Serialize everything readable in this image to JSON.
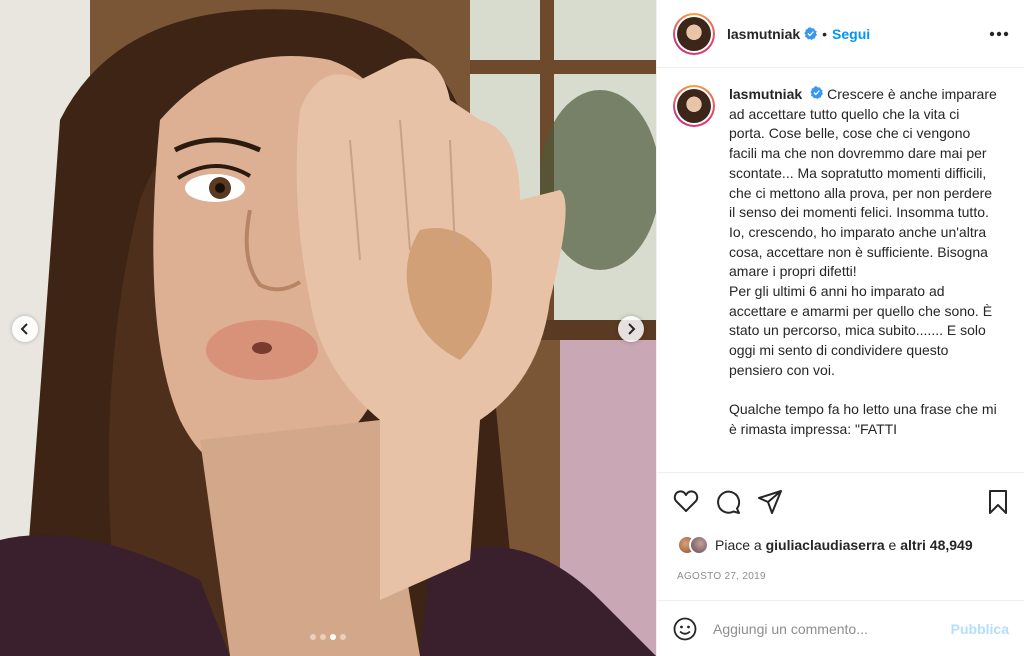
{
  "post": {
    "username": "lasmutniak",
    "follow_label": "Segui",
    "separator": "•",
    "caption": "Crescere è anche imparare ad accettare tutto quello che la vita ci porta. Cose belle, cose che ci vengono facili ma che non dovremmo dare mai per scontate... Ma sopratutto momenti difficili, che ci mettono alla prova, per non perdere il senso dei momenti felici. Insomma tutto.\nIo, crescendo, ho imparato anche un'altra cosa, accettare non è sufficiente. Bisogna amare i propri difetti!\nPer gli ultimi 6 anni ho imparato ad accettare e amarmi per quello che sono. È stato un percorso, mica subito....... E solo oggi mi sento di condividere questo pensiero con voi.\n\nQualche tempo fa ho letto una frase che mi è rimasta impressa: \"FATTI",
    "likes": {
      "prefix": "Piace a",
      "user": "giuliaclaudiaserra",
      "and": "e",
      "others": "altri 48,949"
    },
    "date": "AGOSTO 27, 2019"
  },
  "comment": {
    "placeholder": "Aggiungi un commento...",
    "publish_label": "Pubblica"
  },
  "carousel": {
    "total": 4,
    "active_index": 2
  },
  "colors": {
    "accent": "#0095f6",
    "publish_disabled": "#b2dffc",
    "text": "#262626",
    "muted": "#8e8e8e"
  },
  "icons": [
    "more-options-icon",
    "verified-badge-icon",
    "heart-icon",
    "comment-icon",
    "share-icon",
    "bookmark-icon",
    "emoji-icon",
    "chevron-left-icon",
    "chevron-right-icon"
  ]
}
